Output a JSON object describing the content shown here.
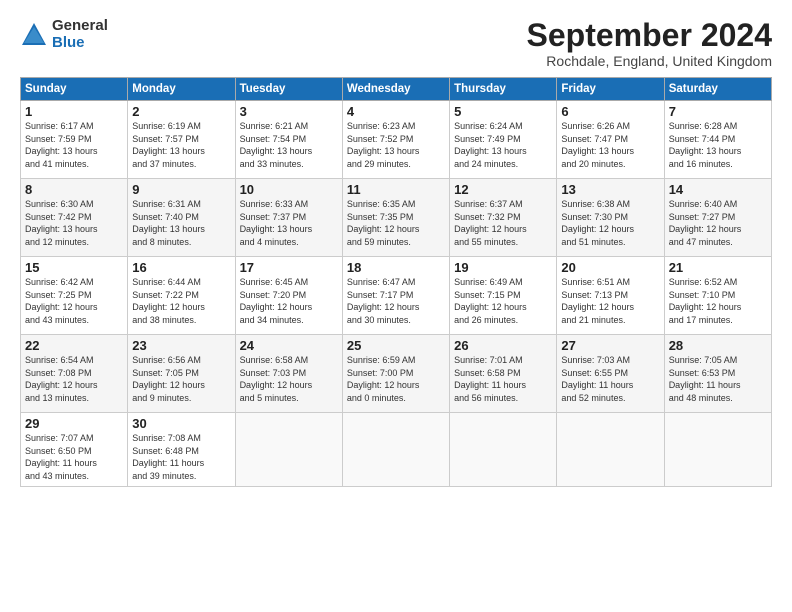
{
  "header": {
    "logo_general": "General",
    "logo_blue": "Blue",
    "month_year": "September 2024",
    "location": "Rochdale, England, United Kingdom"
  },
  "days_of_week": [
    "Sunday",
    "Monday",
    "Tuesday",
    "Wednesday",
    "Thursday",
    "Friday",
    "Saturday"
  ],
  "weeks": [
    [
      {
        "num": "1",
        "info": "Sunrise: 6:17 AM\nSunset: 7:59 PM\nDaylight: 13 hours\nand 41 minutes."
      },
      {
        "num": "2",
        "info": "Sunrise: 6:19 AM\nSunset: 7:57 PM\nDaylight: 13 hours\nand 37 minutes."
      },
      {
        "num": "3",
        "info": "Sunrise: 6:21 AM\nSunset: 7:54 PM\nDaylight: 13 hours\nand 33 minutes."
      },
      {
        "num": "4",
        "info": "Sunrise: 6:23 AM\nSunset: 7:52 PM\nDaylight: 13 hours\nand 29 minutes."
      },
      {
        "num": "5",
        "info": "Sunrise: 6:24 AM\nSunset: 7:49 PM\nDaylight: 13 hours\nand 24 minutes."
      },
      {
        "num": "6",
        "info": "Sunrise: 6:26 AM\nSunset: 7:47 PM\nDaylight: 13 hours\nand 20 minutes."
      },
      {
        "num": "7",
        "info": "Sunrise: 6:28 AM\nSunset: 7:44 PM\nDaylight: 13 hours\nand 16 minutes."
      }
    ],
    [
      {
        "num": "8",
        "info": "Sunrise: 6:30 AM\nSunset: 7:42 PM\nDaylight: 13 hours\nand 12 minutes."
      },
      {
        "num": "9",
        "info": "Sunrise: 6:31 AM\nSunset: 7:40 PM\nDaylight: 13 hours\nand 8 minutes."
      },
      {
        "num": "10",
        "info": "Sunrise: 6:33 AM\nSunset: 7:37 PM\nDaylight: 13 hours\nand 4 minutes."
      },
      {
        "num": "11",
        "info": "Sunrise: 6:35 AM\nSunset: 7:35 PM\nDaylight: 12 hours\nand 59 minutes."
      },
      {
        "num": "12",
        "info": "Sunrise: 6:37 AM\nSunset: 7:32 PM\nDaylight: 12 hours\nand 55 minutes."
      },
      {
        "num": "13",
        "info": "Sunrise: 6:38 AM\nSunset: 7:30 PM\nDaylight: 12 hours\nand 51 minutes."
      },
      {
        "num": "14",
        "info": "Sunrise: 6:40 AM\nSunset: 7:27 PM\nDaylight: 12 hours\nand 47 minutes."
      }
    ],
    [
      {
        "num": "15",
        "info": "Sunrise: 6:42 AM\nSunset: 7:25 PM\nDaylight: 12 hours\nand 43 minutes."
      },
      {
        "num": "16",
        "info": "Sunrise: 6:44 AM\nSunset: 7:22 PM\nDaylight: 12 hours\nand 38 minutes."
      },
      {
        "num": "17",
        "info": "Sunrise: 6:45 AM\nSunset: 7:20 PM\nDaylight: 12 hours\nand 34 minutes."
      },
      {
        "num": "18",
        "info": "Sunrise: 6:47 AM\nSunset: 7:17 PM\nDaylight: 12 hours\nand 30 minutes."
      },
      {
        "num": "19",
        "info": "Sunrise: 6:49 AM\nSunset: 7:15 PM\nDaylight: 12 hours\nand 26 minutes."
      },
      {
        "num": "20",
        "info": "Sunrise: 6:51 AM\nSunset: 7:13 PM\nDaylight: 12 hours\nand 21 minutes."
      },
      {
        "num": "21",
        "info": "Sunrise: 6:52 AM\nSunset: 7:10 PM\nDaylight: 12 hours\nand 17 minutes."
      }
    ],
    [
      {
        "num": "22",
        "info": "Sunrise: 6:54 AM\nSunset: 7:08 PM\nDaylight: 12 hours\nand 13 minutes."
      },
      {
        "num": "23",
        "info": "Sunrise: 6:56 AM\nSunset: 7:05 PM\nDaylight: 12 hours\nand 9 minutes."
      },
      {
        "num": "24",
        "info": "Sunrise: 6:58 AM\nSunset: 7:03 PM\nDaylight: 12 hours\nand 5 minutes."
      },
      {
        "num": "25",
        "info": "Sunrise: 6:59 AM\nSunset: 7:00 PM\nDaylight: 12 hours\nand 0 minutes."
      },
      {
        "num": "26",
        "info": "Sunrise: 7:01 AM\nSunset: 6:58 PM\nDaylight: 11 hours\nand 56 minutes."
      },
      {
        "num": "27",
        "info": "Sunrise: 7:03 AM\nSunset: 6:55 PM\nDaylight: 11 hours\nand 52 minutes."
      },
      {
        "num": "28",
        "info": "Sunrise: 7:05 AM\nSunset: 6:53 PM\nDaylight: 11 hours\nand 48 minutes."
      }
    ],
    [
      {
        "num": "29",
        "info": "Sunrise: 7:07 AM\nSunset: 6:50 PM\nDaylight: 11 hours\nand 43 minutes."
      },
      {
        "num": "30",
        "info": "Sunrise: 7:08 AM\nSunset: 6:48 PM\nDaylight: 11 hours\nand 39 minutes."
      },
      {
        "num": "",
        "info": ""
      },
      {
        "num": "",
        "info": ""
      },
      {
        "num": "",
        "info": ""
      },
      {
        "num": "",
        "info": ""
      },
      {
        "num": "",
        "info": ""
      }
    ]
  ]
}
